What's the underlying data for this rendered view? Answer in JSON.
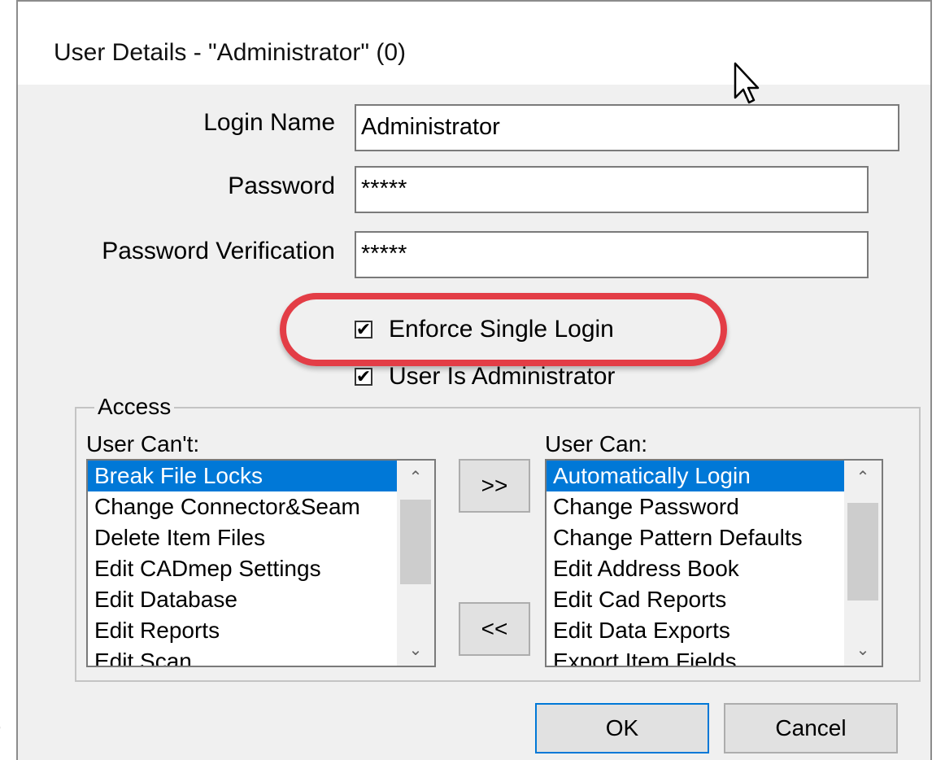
{
  "left_fragment": ")",
  "dialog": {
    "title": "User Details - \"Administrator\" (0)"
  },
  "fields": {
    "login_name": {
      "label": "Login Name",
      "value": "Administrator"
    },
    "password": {
      "label": "Password",
      "value": "*****"
    },
    "password_verification": {
      "label": "Password Verification",
      "value": "*****"
    }
  },
  "checkboxes": {
    "enforce_single_login": {
      "label": "Enforce Single Login",
      "checked": true
    },
    "user_is_administrator": {
      "label": "User Is Administrator",
      "checked": true
    }
  },
  "access": {
    "group_label": "Access",
    "cant": {
      "header": "User Can't:",
      "items": [
        "Break File Locks",
        "Change Connector&Seam",
        "Delete Item Files",
        "Edit CADmep Settings",
        "Edit Database",
        "Edit Reports",
        "Edit Scan..."
      ],
      "selected_index": 0
    },
    "can": {
      "header": "User Can:",
      "items": [
        "Automatically Login",
        "Change Password",
        "Change Pattern Defaults",
        "Edit Address Book",
        "Edit Cad Reports",
        "Edit Data Exports",
        "Export Item Fields"
      ],
      "selected_index": 0
    },
    "move_right_label": ">>",
    "move_left_label": "<<"
  },
  "buttons": {
    "ok": "OK",
    "cancel": "Cancel"
  },
  "colors": {
    "selection": "#0078d7",
    "highlight_ring": "#e33d46"
  }
}
